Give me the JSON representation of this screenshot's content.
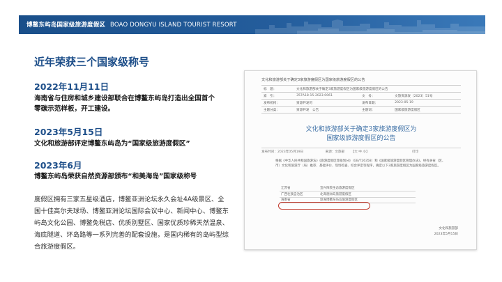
{
  "header": {
    "title_zh": "博鳌东屿岛国家级旅游度假区",
    "title_en": "BOAO DONGYU ISLAND TOURIST RESORT"
  },
  "main": {
    "section_title": "近年荣获三个国家级称号",
    "events": [
      {
        "date": "2022年11月11日",
        "desc": "海南省与住房和城乡建设部联合在博鳌东屿岛打造出全国首个零碳示范样板，开工建设。"
      },
      {
        "date": "2023年5月15日",
        "desc": "文化和旅游部评定博鳌东屿岛为“国家级旅游度假区”"
      },
      {
        "date": "2023年6月",
        "desc": "博鳌东屿岛荣获自然资源部颁布“和美海岛”国家级称号"
      }
    ],
    "body": "度假区拥有三家五星级酒店，博鳌亚洲论坛永久会址4A级景区、全国十佳高尔夫球场、博鳌亚洲论坛国际会议中心、新闻中心、博鳌东屿岛文化公园、博鳌免税店、优质别墅区、国家优质珍稀天然温泉、海底隧道、环岛路等一系列完善的配套设施，是国内稀有的岛屿型综合旅游度假区。"
  },
  "document": {
    "head": "文化和旅游部关于确定3家旅游度假区为国家级旅游度假区的公告",
    "meta_rows": [
      [
        "标　题：",
        "文化和旅游部关于确定3家旅游度假区为国家级旅游度假区的公告"
      ],
      [
        "索　引：",
        "357A18-15-2023-0061",
        "文　号：",
        "文旅资源发〔2023〕51号"
      ],
      [
        "发布机构：",
        "资源开发司",
        "发布日期：",
        "2023-05-19"
      ],
      [
        "主题分类：",
        "资源开发　公告",
        "主题词：",
        "国家级旅游度假区"
      ]
    ],
    "title_line1": "文化和旅游部关于确定3家旅游度假区为",
    "title_line2": "国家级旅游度假区的公告",
    "dateline_left": "发布时间：2023年05月19日",
    "dateline_mid": "来源：文旅部",
    "dateline_right": "【大 中 小】",
    "dateline_print": "打印",
    "paragraph": "根据《中华人民共和国旅游法》《旅游度假区等级划分》（GB/T26358）和《国家级旅游度假区管理办法》，经有关省（区、市）文化和旅游厅（局）推荐、基础评价、现场检查、综合评定等程序，确定以下3家旅游度假区为国家级旅游度假区。",
    "list": [
      [
        "江苏省",
        "宜兴阳羡生态旅游度假区"
      ],
      [
        "广西壮族自治区",
        "北海涠洲岛旅游度假区"
      ],
      [
        "海南省",
        "琼海博鳌东屿岛旅游度假区"
      ]
    ],
    "sign_org": "文化和旅游部",
    "sign_date": "2023年5月15日"
  }
}
